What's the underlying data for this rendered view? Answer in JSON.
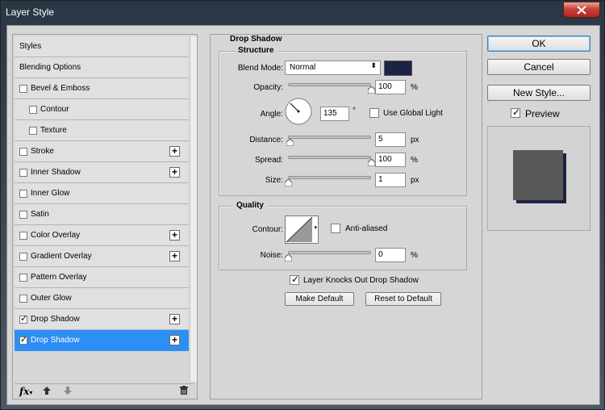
{
  "window": {
    "title": "Layer Style"
  },
  "styles_list": {
    "header": "Styles",
    "items": [
      {
        "label": "Blending Options",
        "checkbox": false,
        "checked": false,
        "indent": false,
        "plus": false,
        "selected": false
      },
      {
        "label": "Bevel & Emboss",
        "checkbox": true,
        "checked": false,
        "indent": false,
        "plus": false,
        "selected": false
      },
      {
        "label": "Contour",
        "checkbox": true,
        "checked": false,
        "indent": true,
        "plus": false,
        "selected": false
      },
      {
        "label": "Texture",
        "checkbox": true,
        "checked": false,
        "indent": true,
        "plus": false,
        "selected": false
      },
      {
        "label": "Stroke",
        "checkbox": true,
        "checked": false,
        "indent": false,
        "plus": true,
        "selected": false
      },
      {
        "label": "Inner Shadow",
        "checkbox": true,
        "checked": false,
        "indent": false,
        "plus": true,
        "selected": false
      },
      {
        "label": "Inner Glow",
        "checkbox": true,
        "checked": false,
        "indent": false,
        "plus": false,
        "selected": false
      },
      {
        "label": "Satin",
        "checkbox": true,
        "checked": false,
        "indent": false,
        "plus": false,
        "selected": false
      },
      {
        "label": "Color Overlay",
        "checkbox": true,
        "checked": false,
        "indent": false,
        "plus": true,
        "selected": false
      },
      {
        "label": "Gradient Overlay",
        "checkbox": true,
        "checked": false,
        "indent": false,
        "plus": true,
        "selected": false
      },
      {
        "label": "Pattern Overlay",
        "checkbox": true,
        "checked": false,
        "indent": false,
        "plus": false,
        "selected": false
      },
      {
        "label": "Outer Glow",
        "checkbox": true,
        "checked": false,
        "indent": false,
        "plus": false,
        "selected": false
      },
      {
        "label": "Drop Shadow",
        "checkbox": true,
        "checked": true,
        "indent": false,
        "plus": true,
        "selected": false
      },
      {
        "label": "Drop Shadow",
        "checkbox": true,
        "checked": true,
        "indent": false,
        "plus": true,
        "selected": true
      }
    ],
    "footer_icons": [
      "fx-icon",
      "move-up-icon",
      "move-down-icon",
      "trash-icon"
    ],
    "fx_label": "fx"
  },
  "drop_shadow": {
    "section_title": "Drop Shadow",
    "structure": {
      "title": "Structure",
      "blend_mode_label": "Blend Mode:",
      "blend_mode_value": "Normal",
      "shadow_color": "#1c2444",
      "opacity_label": "Opacity:",
      "opacity_value": "100",
      "opacity_unit": "%",
      "opacity_level": 1.0,
      "angle_label": "Angle:",
      "angle_value": "135",
      "angle_unit": "°",
      "use_global_light_label": "Use Global Light",
      "use_global_light_checked": false,
      "distance_label": "Distance:",
      "distance_value": "5",
      "distance_unit": "px",
      "distance_level": 0.02,
      "spread_label": "Spread:",
      "spread_value": "100",
      "spread_unit": "%",
      "spread_level": 1.0,
      "size_label": "Size:",
      "size_value": "1",
      "size_unit": "px",
      "size_level": 0.004
    },
    "quality": {
      "title": "Quality",
      "contour_label": "Contour:",
      "anti_aliased_label": "Anti-aliased",
      "anti_aliased_checked": false,
      "noise_label": "Noise:",
      "noise_value": "0",
      "noise_unit": "%",
      "noise_level": 0.0
    },
    "layer_knocks_out_label": "Layer Knocks Out Drop Shadow",
    "layer_knocks_out_checked": true,
    "make_default_label": "Make Default",
    "reset_default_label": "Reset to Default"
  },
  "actions": {
    "ok_label": "OK",
    "cancel_label": "Cancel",
    "new_style_label": "New Style...",
    "preview_label": "Preview",
    "preview_checked": true
  },
  "preview": {
    "swatch_color": "#585858",
    "shadow_color": "#1c2444"
  }
}
